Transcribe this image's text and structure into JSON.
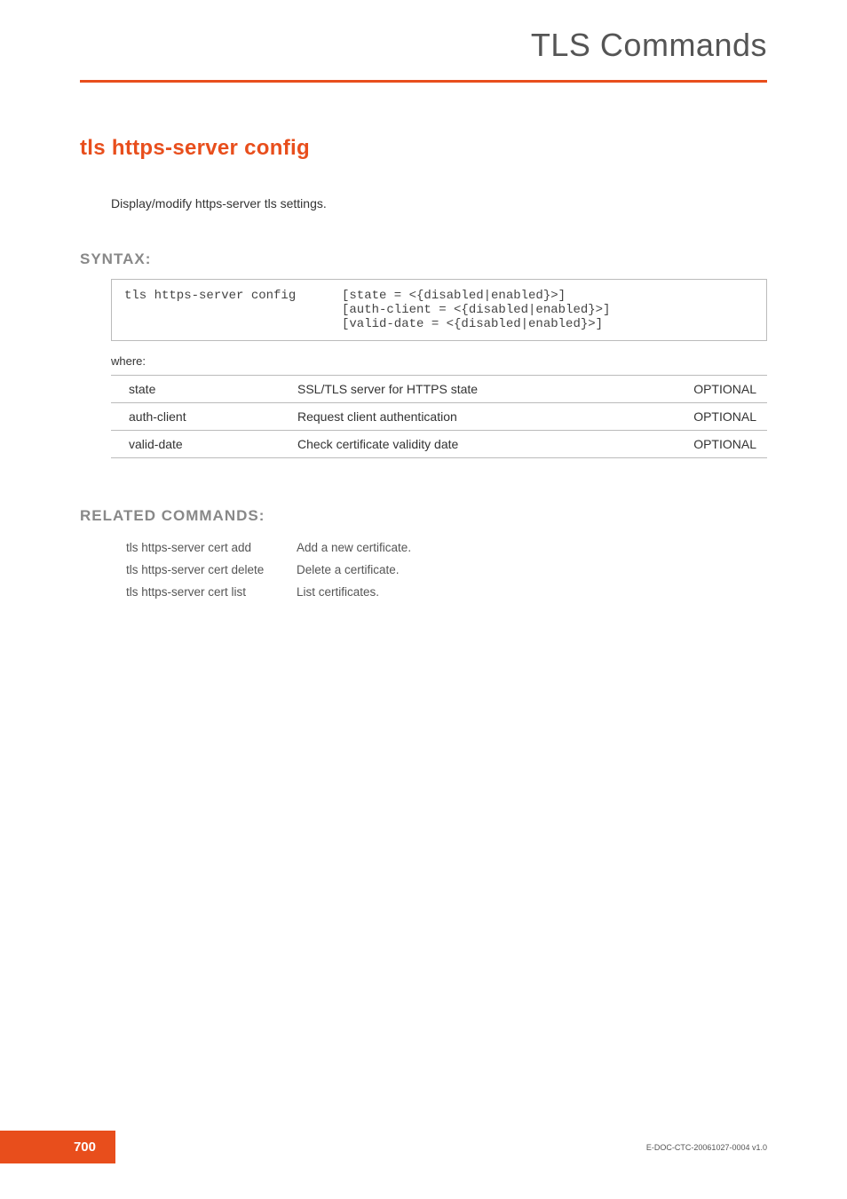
{
  "header": {
    "title": "TLS Commands"
  },
  "section": {
    "title": "tls https-server config",
    "description": "Display/modify https-server tls settings."
  },
  "syntax": {
    "label": "SYNTAX:",
    "command": "tls https-server config",
    "args": "[state = <{disabled|enabled}>]\n[auth-client = <{disabled|enabled}>]\n[valid-date = <{disabled|enabled}>]",
    "where": "where:"
  },
  "params": [
    {
      "name": "state",
      "desc": "SSL/TLS server for HTTPS state",
      "req": "OPTIONAL"
    },
    {
      "name": "auth-client",
      "desc": "Request client authentication",
      "req": "OPTIONAL"
    },
    {
      "name": "valid-date",
      "desc": "Check certificate validity date",
      "req": "OPTIONAL"
    }
  ],
  "related": {
    "label": "RELATED COMMANDS:",
    "items": [
      {
        "cmd": "tls https-server cert add",
        "desc": "Add a new certificate."
      },
      {
        "cmd": "tls https-server cert delete",
        "desc": "Delete a certificate."
      },
      {
        "cmd": "tls https-server cert list",
        "desc": "List certificates."
      }
    ]
  },
  "footer": {
    "page": "700",
    "docid": "E-DOC-CTC-20061027-0004 v1.0"
  }
}
